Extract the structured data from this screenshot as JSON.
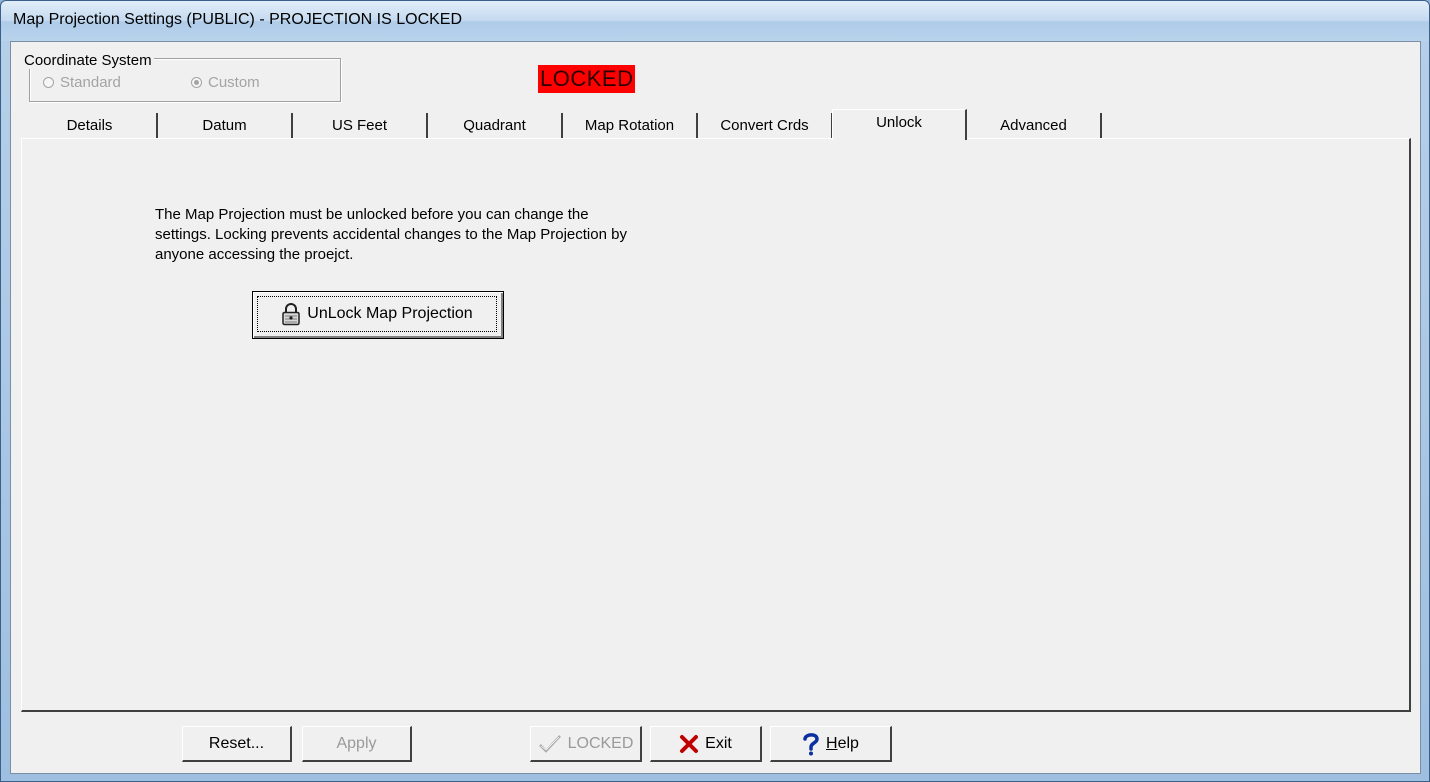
{
  "window": {
    "title": "Map Projection Settings (PUBLIC) - PROJECTION IS LOCKED"
  },
  "coordinate_system": {
    "legend": "Coordinate System",
    "options": [
      {
        "label": "Standard",
        "checked": false,
        "enabled": false
      },
      {
        "label": "Custom",
        "checked": true,
        "enabled": false
      }
    ]
  },
  "status_badge": {
    "text": "LOCKED",
    "color": "#ff0000"
  },
  "tabs": [
    {
      "label": "Details"
    },
    {
      "label": "Datum"
    },
    {
      "label": "US Feet"
    },
    {
      "label": "Quadrant"
    },
    {
      "label": "Map Rotation"
    },
    {
      "label": "Convert Crds"
    },
    {
      "label": "Unlock",
      "active": true
    },
    {
      "label": "Advanced"
    }
  ],
  "unlock_panel": {
    "line1": "The Map Projection must be unlocked before you can change the",
    "line2": "settings. Locking prevents accidental changes to the Map Projection by",
    "line3": "anyone accessing the proejct.",
    "button_label": "UnLock Map Projection",
    "button_icon": "padlock-icon"
  },
  "footer_buttons": {
    "reset": "Reset...",
    "apply": "Apply",
    "locked": "LOCKED",
    "exit": "Exit",
    "help_h": "H",
    "help_rest": "elp"
  },
  "colors": {
    "dialog_bg": "#f0f0f0",
    "title_bar": "#b9d3ec",
    "exit_icon": "#c00000",
    "help_icon": "#0a2fa0"
  }
}
